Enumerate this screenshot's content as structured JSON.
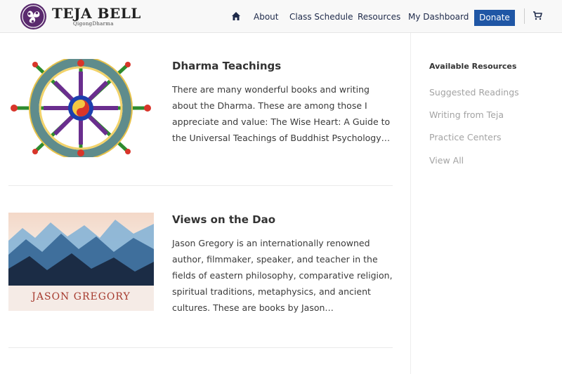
{
  "brand": {
    "title": "Teja Bell",
    "subtitle": "QigongDharma"
  },
  "nav": {
    "home_icon": "home-icon",
    "items": [
      "About",
      "Class Schedule",
      "Resources",
      "My Dashboard"
    ],
    "donate_label": "Donate",
    "cart_icon": "cart-icon"
  },
  "posts": [
    {
      "title": "Dharma Teachings",
      "excerpt": "There are many wonderful books and writing about the Dharma. These are among those I appreciate and value: The Wise Heart: A Guide to the Universal Teachings of Buddhist Psychology…",
      "image": "dharma-wheel"
    },
    {
      "title": "Views on the Dao",
      "excerpt": "Jason Gregory is an internationally renowned author, filmmaker, speaker, and teacher in the fields of eastern philosophy, comparative religion, spiritual traditions, metaphysics, and ancient cultures. These are books by Jason…",
      "image": "mountain-landscape",
      "image_caption": "JASON GREGORY"
    }
  ],
  "sidebar": {
    "title": "Available Resources",
    "links": [
      "Suggested Readings",
      "Writing from Teja",
      "Practice Centers",
      "View All"
    ]
  },
  "colors": {
    "accent": "#1f56a5",
    "nav_text": "#1e2a4a",
    "logo_purple": "#5a2a6e",
    "sidebar_link": "#a3a3a3"
  }
}
